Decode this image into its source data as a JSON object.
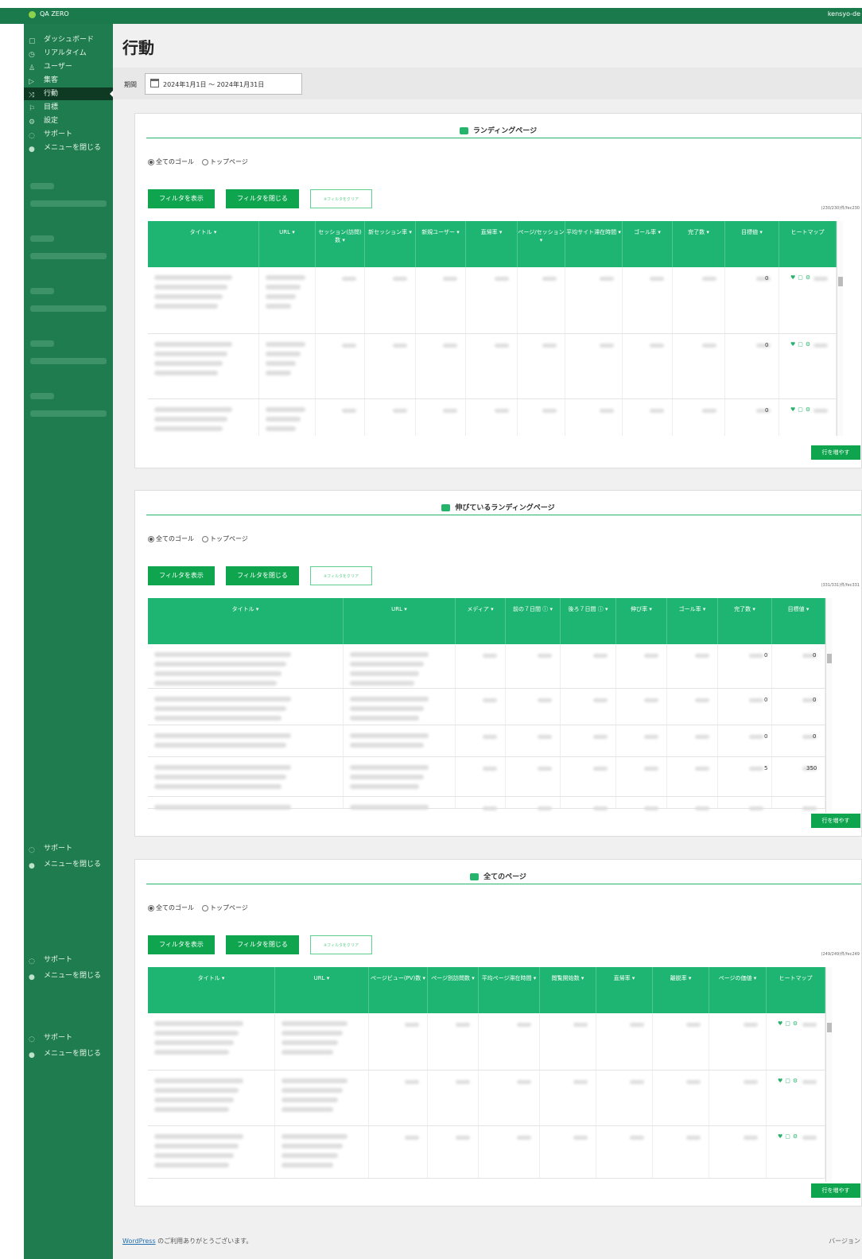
{
  "topbar": {
    "brand": "QA ZERO",
    "user": "kensyo-de"
  },
  "sidebar": {
    "items": [
      {
        "label": "ダッシュボード",
        "icon": "dashboard-icon"
      },
      {
        "label": "リアルタイム",
        "icon": "clock-icon"
      },
      {
        "label": "ユーザー",
        "icon": "user-icon"
      },
      {
        "label": "集客",
        "icon": "funnel-icon"
      },
      {
        "label": "行動",
        "icon": "behavior-icon",
        "active": true
      },
      {
        "label": "目標",
        "icon": "goal-icon"
      },
      {
        "label": "設定",
        "icon": "gear-icon"
      },
      {
        "label": "サポート",
        "icon": "support-icon"
      },
      {
        "label": "メニューを閉じる",
        "icon": "collapse-icon"
      }
    ],
    "extra": [
      "サポート",
      "メニューを閉じる",
      "サポート",
      "メニューを閉じる",
      "サポート",
      "メニューを閉じる"
    ]
  },
  "page": {
    "title": "行動",
    "period_label": "期間",
    "period_value": "2024年1月1日 ～ 2024年1月31日"
  },
  "common": {
    "radio_all": "全てのゴール",
    "radio_top": "トップページ",
    "show_filter": "フィルタを表示",
    "close_filter": "フィルタを閉じる",
    "clear_filter": "※フィルタをクリア",
    "more_rows": "行を増やす"
  },
  "panels": [
    {
      "title": "ランディングページ",
      "count": "(230/230)件/fec230",
      "columns": [
        "タイトル ▾",
        "URL ▾",
        "セッション(訪問) 数 ▾",
        "新セッション率 ▾",
        "新規ユーザー ▾",
        "直帰率 ▾",
        "ページ/セッション ▾",
        "平均サイト滞在時間 ▾",
        "ゴール率 ▾",
        "完了数 ▾",
        "目標値 ▾",
        "ヒートマップ"
      ],
      "rows": [
        {
          "goal": "0"
        },
        {
          "goal": "0"
        },
        {
          "goal": "0"
        }
      ]
    },
    {
      "title": "伸びているランディングページ",
      "count": "(331/331)件/fec331",
      "columns": [
        "タイトル ▾",
        "URL ▾",
        "メディア ▾",
        "前の７日間 ⓘ ▾",
        "後ろ７日間 ⓘ ▾",
        "伸び率 ▾",
        "ゴール率 ▾",
        "完了数 ▾",
        "目標値 ▾"
      ],
      "rows": [
        {
          "done": "0",
          "goal": "0"
        },
        {
          "done": "0",
          "goal": "0"
        },
        {
          "done": "0",
          "goal": "0"
        },
        {
          "done": "5",
          "goal": "350"
        }
      ]
    },
    {
      "title": "全てのページ",
      "count": "(249/249)件/fec249",
      "columns": [
        "タイトル ▾",
        "URL ▾",
        "ページビュー(PV)数 ▾",
        "ページ別訪問数 ▾",
        "平均ページ滞在時間 ▾",
        "閲覧開始数 ▾",
        "直帰率 ▾",
        "離脱率 ▾",
        "ページの価値 ▾",
        "ヒートマップ"
      ],
      "rows": [
        {},
        {},
        {}
      ]
    }
  ],
  "footer": {
    "link": "WordPress",
    "text": " のご利用ありがとうございます。",
    "version": "バージョン"
  }
}
